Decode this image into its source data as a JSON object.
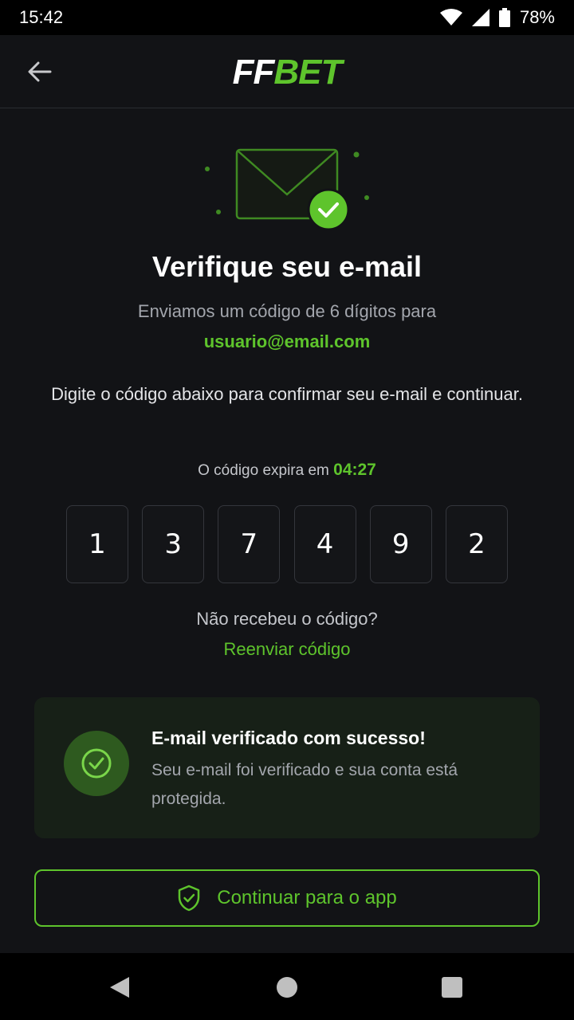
{
  "status_bar": {
    "time": "15:42",
    "battery": "78%",
    "icons": [
      "wifi-icon",
      "signal-icon",
      "battery-icon"
    ]
  },
  "app_bar": {
    "back_icon": "arrow-left-icon",
    "logo_ff": "FF",
    "logo_bet": "BET"
  },
  "hero": {
    "icon": "envelope-check-icon"
  },
  "title": "Verifique seu e-mail",
  "subtitle": "Enviamos um código de 6 dígitos para",
  "email": "usuario@email.com",
  "instructions": "Digite o código abaixo para confirmar seu e-mail e continuar.",
  "expiry": {
    "label": "O código expira em",
    "timer": "04:27"
  },
  "code_digits": [
    "1",
    "3",
    "7",
    "4",
    "9",
    "2"
  ],
  "resend": {
    "question": "Não recebeu o código?",
    "link": "Reenviar código"
  },
  "success": {
    "icon": "check-circle-icon",
    "title": "E-mail verificado com sucesso!",
    "text": "Seu e-mail foi verificado e sua conta está protegida."
  },
  "continue_button": {
    "icon": "shield-check-icon",
    "label": "Continuar para o app"
  },
  "colors": {
    "accent": "#5ec42c",
    "background": "#121316",
    "card": "#172017"
  }
}
